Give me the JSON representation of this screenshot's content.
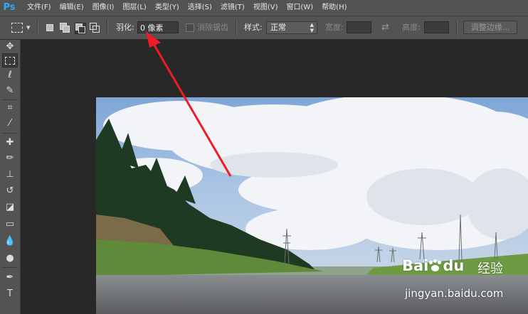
{
  "app": {
    "logo": "Ps"
  },
  "menubar": {
    "items": [
      "文件(F)",
      "编辑(E)",
      "图像(I)",
      "图层(L)",
      "类型(Y)",
      "选择(S)",
      "滤镜(T)",
      "视图(V)",
      "窗口(W)",
      "帮助(H)"
    ]
  },
  "options": {
    "feather_label": "羽化:",
    "feather_value": "0 像素",
    "antialias_label": "消除锯齿",
    "style_label": "样式:",
    "style_value": "正常",
    "width_label": "宽度:",
    "height_label": "高度:",
    "refine_edge_label": "调整边缘..."
  },
  "tools": [
    "move-icon",
    "rect-marquee-icon",
    "lasso-icon",
    "quick-select-icon",
    "crop-icon",
    "eyedropper-icon",
    "healing-brush-icon",
    "brush-icon",
    "clone-stamp-icon",
    "history-brush-icon",
    "eraser-icon",
    "gradient-icon",
    "blur-icon",
    "dodge-icon",
    "pen-icon",
    "type-icon"
  ],
  "watermark": {
    "brand": "Bai",
    "brand_suffix": "du",
    "cn": "经验",
    "url": "jingyan.baidu.com"
  },
  "colors": {
    "ui_bg": "#535353",
    "canvas_bg": "#282828",
    "annotation_arrow": "#ee1c25",
    "ps_blue": "#31a8ff"
  }
}
